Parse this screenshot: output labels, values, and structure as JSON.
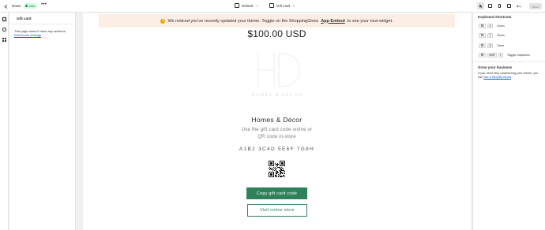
{
  "topbar": {
    "store_name": "Dawn",
    "live_label": "Live",
    "more_label": "•••",
    "theme_select": "Default",
    "page_select": "Gift card",
    "save_label": "Save"
  },
  "sidebar": {
    "title": "Gift card",
    "empty_message": "This page doesn't have any sections.",
    "edit_link": "Edit theme settings"
  },
  "preview": {
    "banner_text_before": "We noticed you've recently updated your theme. Toggle on the ShoppingGives",
    "banner_link": "App Embed",
    "banner_text_after": "to see your new widget.",
    "amount": "$100.00 USD",
    "logo_letters": "HD",
    "logo_text": "HOMES & DÉCOR",
    "store_title": "Homes & Décor",
    "instructions_line1": "Use the gift card code online or",
    "instructions_line2": "QR code in-store",
    "gift_code": "A1B2 3C4D 5E6F 7G8H",
    "copy_button": "Copy gift card code",
    "visit_button": "Visit online store"
  },
  "rightpanel": {
    "shortcuts_title": "Keyboard shortcuts",
    "shortcuts": [
      {
        "modifier": "⌘",
        "key": "Z",
        "label": "Undo"
      },
      {
        "modifier": "⌘",
        "key": "Y",
        "label": "Redo"
      },
      {
        "modifier": "⌘",
        "key": "S",
        "label": "Save"
      },
      {
        "modifier": "⌘",
        "key": "shift",
        "key2": "I",
        "label": "Toggle inspector"
      }
    ],
    "grow_title": "Grow your business",
    "grow_text_before": "If you need help customizing your theme, you can",
    "grow_link": "hire a Shopify expert",
    "grow_text_after": "."
  },
  "colors": {
    "accent_green": "#2f8159",
    "banner_bg": "#fdeee5",
    "link_blue": "#005bd3"
  }
}
